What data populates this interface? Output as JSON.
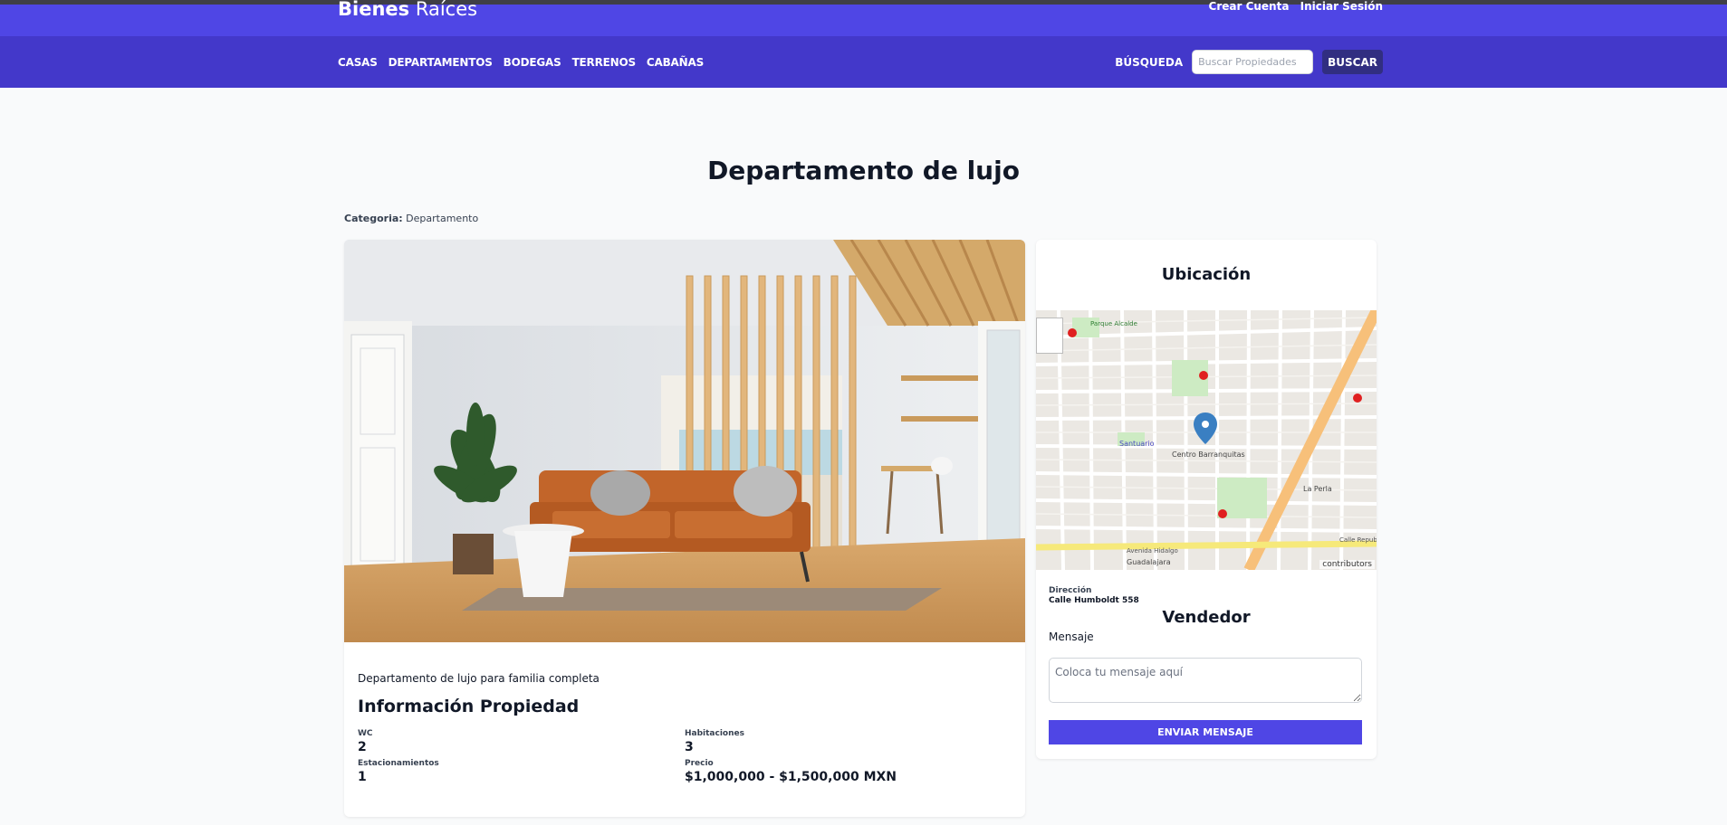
{
  "header": {
    "brand_bold": "Bienes",
    "brand_light": "Raíces",
    "create_account": "Crear Cuenta",
    "login": "Iniciar Sesión"
  },
  "nav": {
    "items": [
      {
        "label": "CASAS"
      },
      {
        "label": "DEPARTAMENTOS"
      },
      {
        "label": "BODEGAS"
      },
      {
        "label": "TERRENOS"
      },
      {
        "label": "CABAÑAS"
      }
    ],
    "search_label": "BÚSQUEDA",
    "search_placeholder": "Buscar Propiedades",
    "search_button": "BUSCAR"
  },
  "property": {
    "title": "Departamento de lujo",
    "category_label": "Categoria:",
    "category_value": "Departamento",
    "description": "Departamento de lujo para familia completa",
    "info_title": "Información Propiedad",
    "stats": [
      {
        "label": "WC",
        "value": "2"
      },
      {
        "label": "Habitaciones",
        "value": "3"
      },
      {
        "label": "Estacionamientos",
        "value": "1"
      },
      {
        "label": "Precio",
        "value": "$1,000,000 - $1,500,000 MXN"
      }
    ]
  },
  "sidebar": {
    "location_title": "Ubicación",
    "map_attribution": "contributors",
    "map_labels": {
      "park": "Parque Alcalde",
      "santuario": "Santuario",
      "centro": "Centro Barranquitas",
      "perla": "La Perla",
      "guadalajara": "Guadalajara",
      "hidalgo": "Avenida Hidalgo",
      "republica": "Calle Repub"
    },
    "address_label": "Dirección",
    "address_value": "Calle Humboldt 558",
    "seller_title": "Vendedor",
    "message_label": "Mensaje",
    "message_placeholder": "Coloca tu mensaje aquí",
    "send_button": "ENVIAR MENSAJE"
  },
  "colors": {
    "header_top": "#4f46e5",
    "navbar": "#4338ca",
    "button_primary": "#4f46e5",
    "button_search": "#312e81"
  }
}
